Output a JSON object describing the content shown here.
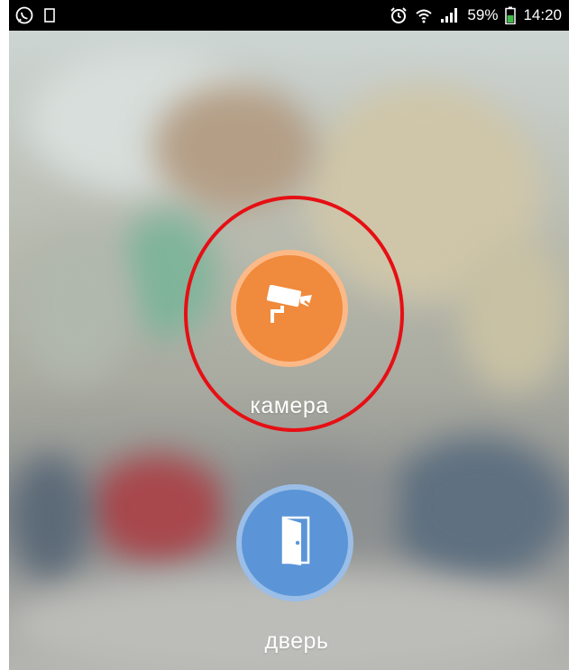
{
  "status_bar": {
    "battery_percent": "59%",
    "time": "14:20",
    "icons": [
      "whatsapp-icon",
      "notification-square-icon",
      "alarm-icon",
      "wifi-icon",
      "signal-icon",
      "battery-icon"
    ]
  },
  "actions": {
    "camera": {
      "label": "камера",
      "icon": "security-camera-icon",
      "color": "#f08a3c"
    },
    "door": {
      "label": "дверь",
      "icon": "door-icon",
      "color": "#5b95d8"
    }
  },
  "annotation": {
    "color": "#e60f14"
  }
}
